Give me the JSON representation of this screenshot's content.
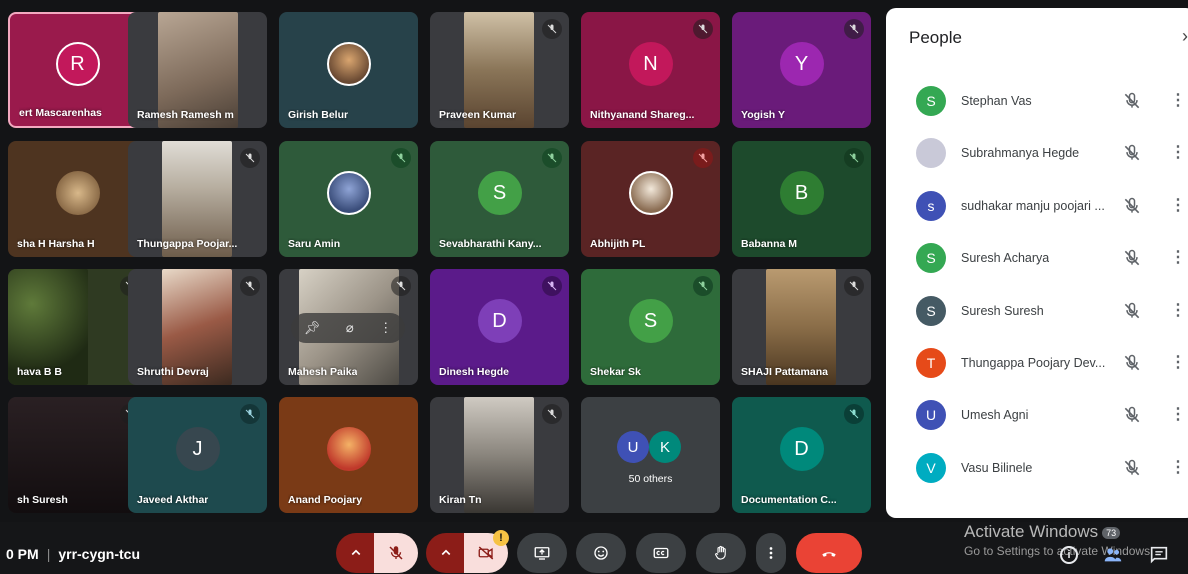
{
  "tiles": [
    {
      "name": "ert Mascarenhas",
      "initial": "R"
    },
    {
      "name": "Ramesh Ramesh m"
    },
    {
      "name": "Girish Belur"
    },
    {
      "name": "Praveen Kumar"
    },
    {
      "name": "Nithyanand Shareg...",
      "initial": "N"
    },
    {
      "name": "Yogish Y",
      "initial": "Y"
    },
    {
      "name": "sha H Harsha H"
    },
    {
      "name": "Thungappa Poojar..."
    },
    {
      "name": "Saru Amin"
    },
    {
      "name": "Sevabharathi Kany...",
      "initial": "S"
    },
    {
      "name": "Abhijith PL"
    },
    {
      "name": "Babanna M",
      "initial": "B"
    },
    {
      "name": "hava B B"
    },
    {
      "name": "Shruthi Devraj"
    },
    {
      "name": "Mahesh Paika"
    },
    {
      "name": "Dinesh Hegde",
      "initial": "D"
    },
    {
      "name": "Shekar Sk",
      "initial": "S"
    },
    {
      "name": "SHAJI Pattamana"
    },
    {
      "name": "sh Suresh"
    },
    {
      "name": "Javeed Akthar",
      "initial": "J"
    },
    {
      "name": "Anand Poojary"
    },
    {
      "name": "Kiran Tn"
    },
    {
      "name": "50 others",
      "initials": [
        "U",
        "K"
      ]
    },
    {
      "name": "Documentation C...",
      "initial": "D"
    }
  ],
  "people_panel": {
    "title": "People",
    "close": "›",
    "people": [
      {
        "name": "Stephan Vas",
        "initial": "S",
        "color": "#34a853"
      },
      {
        "name": "Subrahmanya Hegde",
        "initial": "",
        "color": "#c9c9d8"
      },
      {
        "name": "sudhakar manju poojari ...",
        "initial": "s",
        "color": "#3f51b5"
      },
      {
        "name": "Suresh Acharya",
        "initial": "S",
        "color": "#34a853"
      },
      {
        "name": "Suresh Suresh",
        "initial": "S",
        "color": "#455a64"
      },
      {
        "name": "Thungappa Poojary Dev...",
        "initial": "T",
        "color": "#e64a19"
      },
      {
        "name": "Umesh Agni",
        "initial": "U",
        "color": "#3f51b5"
      },
      {
        "name": "Vasu Bilinele",
        "initial": "V",
        "color": "#00acc1"
      }
    ]
  },
  "bottom_bar": {
    "time": "0 PM",
    "meeting_code": "yrr-cygn-tcu",
    "warning": "!"
  },
  "watermark": {
    "line1": "Activate Windows",
    "count": "73",
    "line2": "Go to Settings to activate Windows."
  }
}
